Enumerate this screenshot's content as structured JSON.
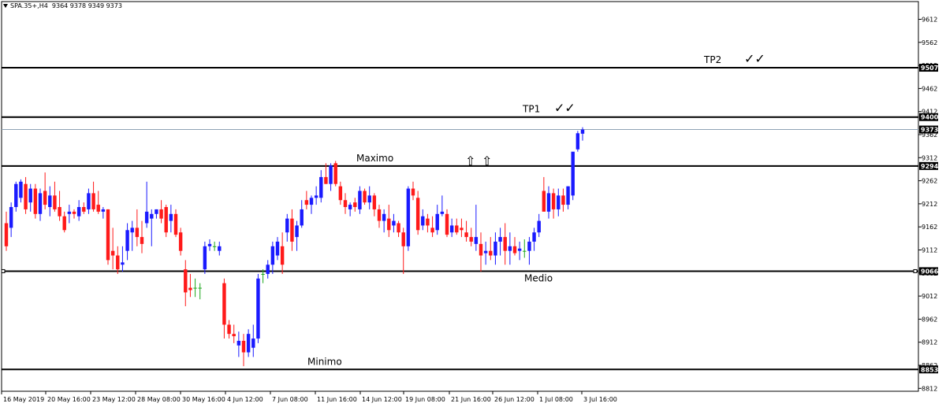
{
  "header": {
    "symbol_line": "SPA.35+,H4  9364 9378 9349 9373"
  },
  "colors": {
    "bull": "#1a1aff",
    "bear": "#ff1a1a",
    "doji": "#1ea81e",
    "line": "#000000",
    "price_line": "#8fa3b5"
  },
  "chart_data": {
    "type": "candlestick",
    "title": "",
    "symbol": "SPA.35+",
    "timeframe": "H4",
    "ohlc_last": {
      "open": 9364,
      "high": 9378,
      "low": 9349,
      "close": 9373
    },
    "ylim": [
      8812,
      9612
    ],
    "y_ticks": [
      9612,
      9562,
      9512,
      9462,
      9412,
      9362,
      9312,
      9262,
      9212,
      9162,
      9112,
      9062,
      9012,
      8962,
      8912,
      8862,
      8812
    ],
    "x_ticks": [
      "16 May 2019",
      "20 May 16:00",
      "23 May 12:00",
      "28 May 08:00",
      "30 May 16:00",
      "4 Jun 12:00",
      "7 Jun 08:00",
      "11 Jun 16:00",
      "14 Jun 12:00",
      "19 Jun 08:00",
      "21 Jun 16:00",
      "26 Jun 12:00",
      "1 Jul 08:00",
      "3 Jul 16:00"
    ],
    "levels": [
      {
        "name": "TP2",
        "value": 9507,
        "label": "TP2",
        "check": "✓✓"
      },
      {
        "name": "TP1",
        "value": 9400,
        "label": "TP1",
        "check": "✓✓"
      },
      {
        "name": "Maximo",
        "value": 9294,
        "label": "Maximo"
      },
      {
        "name": "Medio",
        "value": 9066,
        "label": "Medio"
      },
      {
        "name": "Minimo",
        "value": 8853,
        "label": "Minimo"
      }
    ],
    "price_line": {
      "value": 9373,
      "label": "9373"
    },
    "arrows": [
      "⇧",
      "⇧"
    ],
    "candles": [
      [
        9170,
        9195,
        9110,
        9120
      ],
      [
        9160,
        9215,
        9140,
        9205
      ],
      [
        9205,
        9260,
        9195,
        9255
      ],
      [
        9225,
        9265,
        9215,
        9260
      ],
      [
        9255,
        9270,
        9190,
        9200
      ],
      [
        9215,
        9255,
        9195,
        9245
      ],
      [
        9245,
        9255,
        9180,
        9190
      ],
      [
        9190,
        9245,
        9175,
        9235
      ],
      [
        9240,
        9280,
        9200,
        9210
      ],
      [
        9205,
        9250,
        9185,
        9230
      ],
      [
        9230,
        9260,
        9195,
        9200
      ],
      [
        9205,
        9240,
        9175,
        9185
      ],
      [
        9185,
        9195,
        9150,
        9155
      ],
      [
        9190,
        9210,
        9170,
        9195
      ],
      [
        9195,
        9200,
        9180,
        9190
      ],
      [
        9185,
        9220,
        9175,
        9205
      ],
      [
        9205,
        9215,
        9190,
        9195
      ],
      [
        9200,
        9245,
        9190,
        9235
      ],
      [
        9235,
        9260,
        9195,
        9200
      ],
      [
        9210,
        9240,
        9190,
        9195
      ],
      [
        9195,
        9205,
        9180,
        9200
      ],
      [
        9200,
        9200,
        9080,
        9090
      ],
      [
        9110,
        9160,
        9070,
        9100
      ],
      [
        9100,
        9120,
        9060,
        9070
      ],
      [
        9080,
        9120,
        9065,
        9085
      ],
      [
        9110,
        9170,
        9090,
        9155
      ],
      [
        9150,
        9175,
        9110,
        9160
      ],
      [
        9160,
        9200,
        9120,
        9140
      ],
      [
        9140,
        9175,
        9105,
        9125
      ],
      [
        9170,
        9260,
        9160,
        9195
      ],
      [
        9180,
        9200,
        9120,
        9190
      ],
      [
        9190,
        9200,
        9180,
        9200
      ],
      [
        9200,
        9220,
        9170,
        9180
      ],
      [
        9205,
        9210,
        9140,
        9150
      ],
      [
        9175,
        9210,
        9150,
        9190
      ],
      [
        9190,
        9200,
        9140,
        9145
      ],
      [
        9150,
        9160,
        9100,
        9110
      ],
      [
        9070,
        9090,
        8990,
        9020
      ],
      [
        9030,
        9060,
        9010,
        9025
      ],
      [
        9030,
        9050,
        9010,
        9030
      ],
      [
        9030,
        9040,
        9005,
        9030
      ],
      [
        9070,
        9130,
        9060,
        9120
      ],
      [
        9120,
        9135,
        9110,
        9125
      ],
      [
        9120,
        9130,
        9110,
        9120
      ],
      [
        9110,
        9130,
        9100,
        9120
      ],
      [
        9040,
        9050,
        8920,
        8950
      ],
      [
        8950,
        8960,
        8920,
        8930
      ],
      [
        8930,
        8950,
        8910,
        8925
      ],
      [
        8905,
        8935,
        8880,
        8915
      ],
      [
        8915,
        8930,
        8860,
        8890
      ],
      [
        8890,
        8940,
        8880,
        8930
      ],
      [
        8900,
        8950,
        8880,
        8920
      ],
      [
        8920,
        9060,
        8910,
        9050
      ],
      [
        9060,
        9070,
        9040,
        9060
      ],
      [
        9060,
        9090,
        9050,
        9080
      ],
      [
        9080,
        9130,
        9060,
        9120
      ],
      [
        9100,
        9140,
        9090,
        9130
      ],
      [
        9120,
        9150,
        9060,
        9080
      ],
      [
        9150,
        9190,
        9130,
        9180
      ],
      [
        9180,
        9200,
        9110,
        9130
      ],
      [
        9140,
        9175,
        9110,
        9165
      ],
      [
        9165,
        9220,
        9160,
        9200
      ],
      [
        9220,
        9240,
        9200,
        9210
      ],
      [
        9210,
        9230,
        9190,
        9225
      ],
      [
        9225,
        9250,
        9210,
        9230
      ],
      [
        9225,
        9285,
        9215,
        9270
      ],
      [
        9270,
        9300,
        9255,
        9255
      ],
      [
        9255,
        9300,
        9240,
        9295
      ],
      [
        9300,
        9305,
        9250,
        9255
      ],
      [
        9250,
        9260,
        9210,
        9220
      ],
      [
        9220,
        9235,
        9190,
        9205
      ],
      [
        9200,
        9215,
        9185,
        9210
      ],
      [
        9215,
        9225,
        9195,
        9205
      ],
      [
        9200,
        9250,
        9190,
        9240
      ],
      [
        9240,
        9245,
        9210,
        9215
      ],
      [
        9215,
        9250,
        9200,
        9230
      ],
      [
        9230,
        9235,
        9185,
        9200
      ],
      [
        9200,
        9210,
        9160,
        9175
      ],
      [
        9175,
        9200,
        9150,
        9190
      ],
      [
        9180,
        9210,
        9140,
        9155
      ],
      [
        9165,
        9190,
        9150,
        9175
      ],
      [
        9170,
        9175,
        9140,
        9150
      ],
      [
        9150,
        9160,
        9060,
        9120
      ],
      [
        9120,
        9250,
        9110,
        9245
      ],
      [
        9245,
        9260,
        9220,
        9230
      ],
      [
        9225,
        9240,
        9145,
        9155
      ],
      [
        9165,
        9200,
        9155,
        9185
      ],
      [
        9180,
        9190,
        9150,
        9165
      ],
      [
        9160,
        9185,
        9140,
        9150
      ],
      [
        9155,
        9210,
        9145,
        9190
      ],
      [
        9190,
        9230,
        9185,
        9195
      ],
      [
        9190,
        9200,
        9140,
        9145
      ],
      [
        9150,
        9180,
        9140,
        9165
      ],
      [
        9165,
        9180,
        9145,
        9150
      ],
      [
        9160,
        9180,
        9140,
        9155
      ],
      [
        9150,
        9175,
        9130,
        9140
      ],
      [
        9140,
        9160,
        9120,
        9130
      ],
      [
        9125,
        9210,
        9110,
        9140
      ],
      [
        9125,
        9150,
        9065,
        9100
      ],
      [
        9105,
        9130,
        9080,
        9110
      ],
      [
        9110,
        9140,
        9090,
        9100
      ],
      [
        9100,
        9150,
        9080,
        9130
      ],
      [
        9130,
        9160,
        9100,
        9140
      ],
      [
        9140,
        9170,
        9080,
        9110
      ],
      [
        9110,
        9150,
        9080,
        9120
      ],
      [
        9120,
        9140,
        9100,
        9105
      ],
      [
        9110,
        9130,
        9090,
        9115
      ],
      [
        9110,
        9135,
        9095,
        9110
      ],
      [
        9110,
        9140,
        9080,
        9130
      ],
      [
        9130,
        9160,
        9110,
        9150
      ],
      [
        9150,
        9190,
        9140,
        9175
      ],
      [
        9240,
        9270,
        9200,
        9195
      ],
      [
        9195,
        9250,
        9180,
        9235
      ],
      [
        9235,
        9245,
        9180,
        9200
      ],
      [
        9200,
        9245,
        9185,
        9230
      ],
      [
        9230,
        9245,
        9195,
        9210
      ],
      [
        9210,
        9250,
        9200,
        9250
      ],
      [
        9230,
        9320,
        9220,
        9325
      ],
      [
        9330,
        9370,
        9325,
        9365
      ],
      [
        9364,
        9378,
        9349,
        9373
      ]
    ]
  }
}
